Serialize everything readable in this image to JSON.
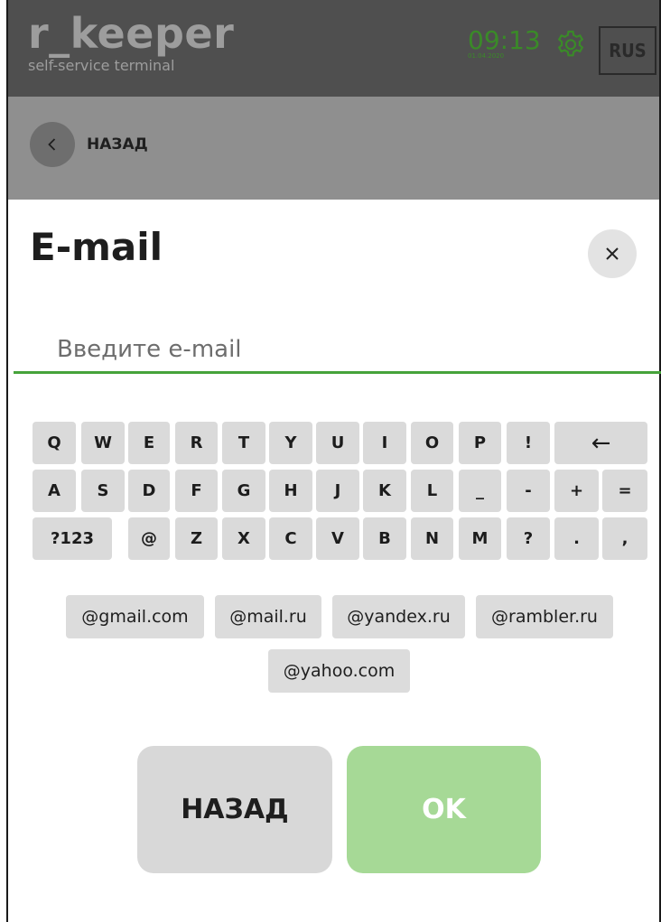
{
  "header": {
    "brand_name": "r_keeper",
    "brand_sub": "self-service terminal",
    "time": "09:13",
    "date": "01.04.2020",
    "language": "RUS",
    "icons": {
      "settings": "gear-icon"
    }
  },
  "backbar": {
    "label": "НАЗАД",
    "icon": "chevron-left-icon"
  },
  "dialog": {
    "title": "E-mail",
    "close_icon": "close-icon",
    "input": {
      "value": "",
      "placeholder": "Введите e-mail"
    }
  },
  "keyboard": {
    "rows": [
      [
        "Q",
        "W",
        "E",
        "R",
        "T",
        "Y",
        "U",
        "I",
        "O",
        "P",
        "!",
        "←"
      ],
      [
        "A",
        "S",
        "D",
        "F",
        "G",
        "H",
        "J",
        "K",
        "L",
        "_",
        "-",
        "+",
        "="
      ],
      [
        "?123",
        "@",
        "Z",
        "X",
        "C",
        "V",
        "B",
        "N",
        "M",
        "?",
        ".",
        ","
      ]
    ]
  },
  "suggestions": [
    "@gmail.com",
    "@mail.ru",
    "@yandex.ru",
    "@rambler.ru",
    "@yahoo.com"
  ],
  "buttons": {
    "back": "НАЗАД",
    "ok": "OK"
  },
  "colors": {
    "accent": "#46a33a",
    "ok_button": "#a6d996",
    "header_bg": "#4f4f4f",
    "backbar_bg": "#8f8f8f"
  }
}
